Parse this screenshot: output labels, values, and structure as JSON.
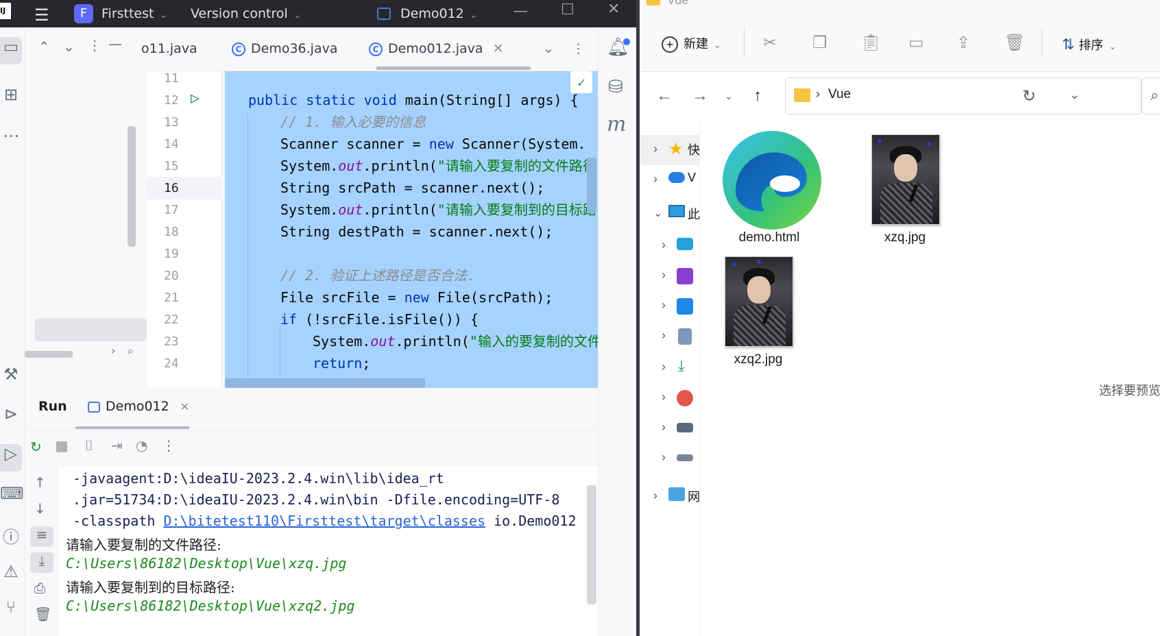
{
  "ide": {
    "titlebar": {
      "project_initial": "F",
      "project_name": "Firsttest",
      "vcs_label": "Version control",
      "run_config": "Demo012"
    },
    "tabs": [
      {
        "label": "o11.java"
      },
      {
        "label": "Demo36.java"
      },
      {
        "label": "Demo012.java"
      }
    ],
    "line_numbers": [
      "11",
      "12",
      "13",
      "14",
      "15",
      "16",
      "17",
      "18",
      "19",
      "20",
      "21",
      "22",
      "23",
      "24"
    ],
    "code": {
      "l12_kw": "public static void",
      "l12_rest": " main(String[] args) {",
      "l13": "// 1. 输入必要的信息",
      "l14_a": "Scanner scanner = ",
      "l14_kw": "new",
      "l14_b": " Scanner(System.",
      "l15_a": "System.",
      "l15_f": "out",
      "l15_b": ".println(",
      "l15_s": "\"请输入要复制的文件路径",
      "l16": "String srcPath = scanner.next();",
      "l17_a": "System.",
      "l17_f": "out",
      "l17_b": ".println(",
      "l17_s": "\"请输入要复制到的目标路",
      "l18": "String destPath = scanner.next();",
      "l20": "// 2. 验证上述路径是否合法.",
      "l21_a": "File srcFile = ",
      "l21_kw": "new",
      "l21_b": " File(srcPath);",
      "l22_kw": "if",
      "l22_b": " (!srcFile.isFile()) {",
      "l23_a": "System.",
      "l23_f": "out",
      "l23_b": ".println(",
      "l23_s": "\"输入的要复制的文件",
      "l24_kw": "return",
      "l24_b": ";"
    },
    "run": {
      "title": "Run",
      "tab": "Demo012"
    },
    "console": {
      "l1": "-javaagent:D:\\ideaIU-2023.2.4.win\\lib\\idea_rt",
      "l2": ".jar=51734:D:\\ideaIU-2023.2.4.win\\bin -Dfile.encoding=UTF-8",
      "l3_a": "-classpath ",
      "l3_link": "D:\\bitetest110\\Firsttest\\target\\classes",
      "l3_b": " io.Demo012",
      "l4": "请输入要复制的文件路径:",
      "l5": "C:\\Users\\86182\\Desktop\\Vue\\xzq.jpg",
      "l6": "请输入要复制到的目标路径:",
      "l7": "C:\\Users\\86182\\Desktop\\Vue\\xzq2.jpg"
    }
  },
  "explorer": {
    "window_title": "Vue",
    "new_label": "新建",
    "sort_label": "排序",
    "address_folder": "Vue",
    "files": [
      {
        "name": "demo.html"
      },
      {
        "name": "xzq.jpg"
      },
      {
        "name": "xzq2.jpg"
      }
    ],
    "nav_quick_access_partial": "快",
    "nav_onedrive_partial": "V",
    "nav_this_pc_partial": "此",
    "nav_network_partial": "网",
    "preview_hint": "选择要预览"
  }
}
